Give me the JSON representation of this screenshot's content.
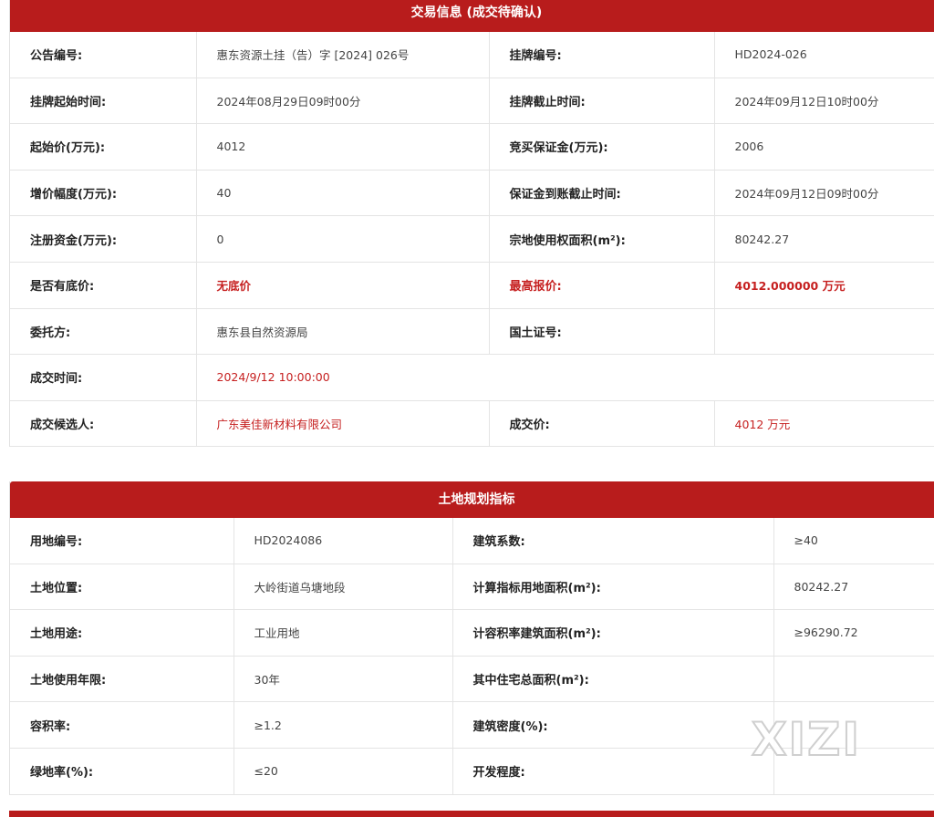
{
  "trade_panel": {
    "title": "交易信息 (成交待确认)",
    "rows": [
      {
        "l1": "公告编号:",
        "v1": "惠东资源土挂（告）字 [2024] 026号",
        "l2": "挂牌编号:",
        "v2": "HD2024-026"
      },
      {
        "l1": "挂牌起始时间:",
        "v1": "2024年08月29日09时00分",
        "l2": "挂牌截止时间:",
        "v2": "2024年09月12日10时00分"
      },
      {
        "l1": "起始价(万元):",
        "v1": "4012",
        "l2": "竞买保证金(万元):",
        "v2": "2006"
      },
      {
        "l1": "增价幅度(万元):",
        "v1": "40",
        "l2": "保证金到账截止时间:",
        "v2": "2024年09月12日09时00分"
      },
      {
        "l1": "注册资金(万元):",
        "v1": "0",
        "l2": "宗地使用权面积(m²):",
        "v2": "80242.27"
      },
      {
        "l1": "是否有底价:",
        "v1": "无底价",
        "l2": "最高报价:",
        "v2": "4012.000000 万元"
      },
      {
        "l1": "委托方:",
        "v1": "惠东县自然资源局",
        "l2": "国土证号:",
        "v2": ""
      },
      {
        "l1": "成交时间:",
        "v1": "2024/9/12 10:00:00"
      },
      {
        "l1": "成交候选人:",
        "v1": "广东美佳新材料有限公司",
        "l2": "成交价:",
        "v2": "4012 万元"
      }
    ]
  },
  "land_panel": {
    "title": "土地规划指标",
    "rows": [
      {
        "l1": "用地编号:",
        "v1": "HD2024086",
        "l2": "建筑系数:",
        "v2": "≥40"
      },
      {
        "l1": "土地位置:",
        "v1": "大岭街道乌塘地段",
        "l2": "计算指标用地面积(m²):",
        "v2": "80242.27"
      },
      {
        "l1": "土地用途:",
        "v1": "工业用地",
        "l2": "计容积率建筑面积(m²):",
        "v2": "≥96290.72"
      },
      {
        "l1": "土地使用年限:",
        "v1": "30年",
        "l2": "其中住宅总面积(m²):",
        "v2": ""
      },
      {
        "l1": "容积率:",
        "v1": "≥1.2",
        "l2": "建筑密度(%):",
        "v2": ""
      },
      {
        "l1": "绿地率(%):",
        "v1": "≤20",
        "l2": "开发程度:",
        "v2": ""
      }
    ]
  },
  "watermark": "XIZI",
  "colors": {
    "header_red": "#b81c1c",
    "text_red": "#c62020"
  }
}
